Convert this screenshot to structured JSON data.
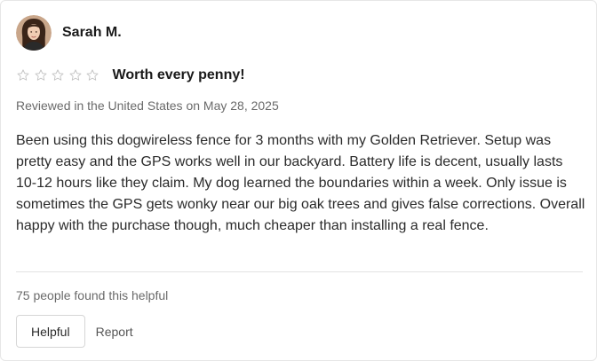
{
  "reviewer": {
    "name": "Sarah M.",
    "avatar_icon": "avatar-photo"
  },
  "rating": {
    "value": 0,
    "max": 5,
    "star_outline_color": "#c4c4c4"
  },
  "review": {
    "title": "Worth every penny!",
    "meta": "Reviewed in the United States on May 28, 2025",
    "body": "Been using this dogwireless fence for 3 months with my Golden Retriever. Setup was pretty easy and the GPS works well in our backyard. Battery life is decent, usually lasts 10-12 hours like they claim. My dog learned the boundaries within a week. Only issue is sometimes the GPS gets wonky near our big oak trees and gives false corrections. Overall happy with the purchase though, much cheaper than installing a real fence."
  },
  "footer": {
    "helpful_count_text": "75 people found this helpful",
    "helpful_button_label": "Helpful",
    "report_label": "Report"
  }
}
